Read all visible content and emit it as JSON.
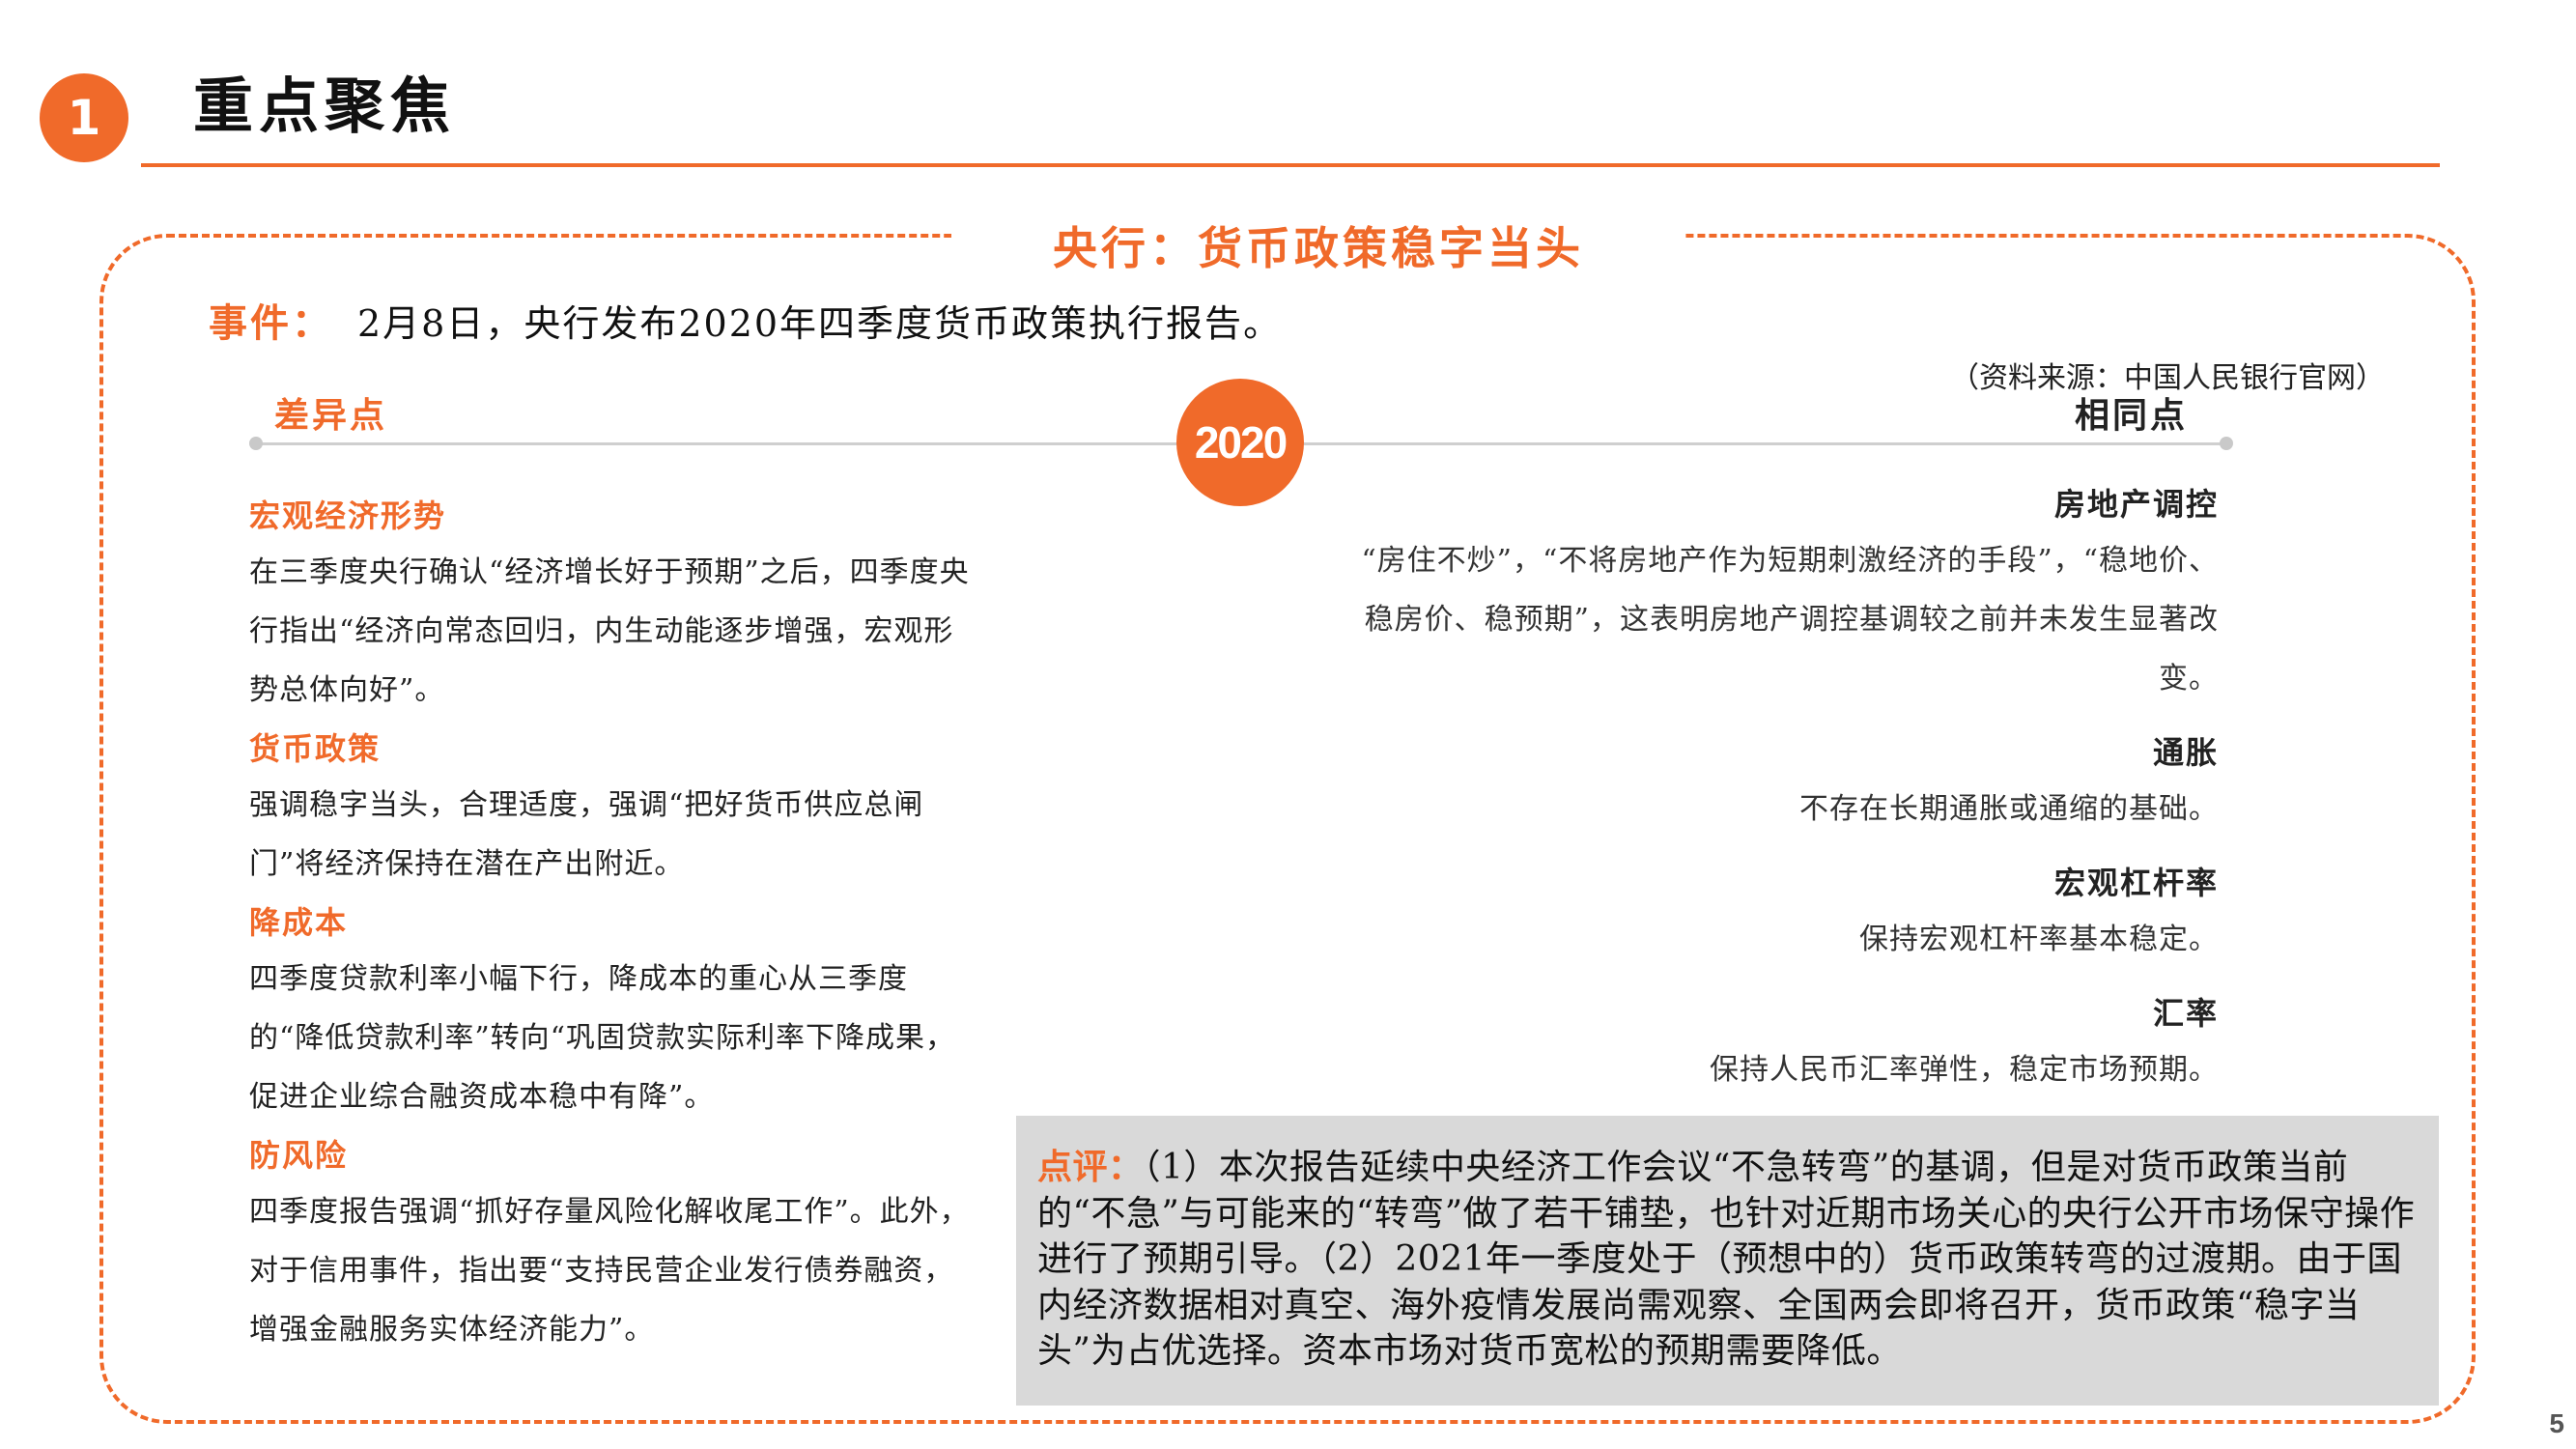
{
  "header": {
    "section_number": "1",
    "section_title": "重点聚焦"
  },
  "main_title": "央行：货币政策稳字当头",
  "event": {
    "label": "事件：",
    "text": "2月8日，央行发布2020年四季度货币政策执行报告。"
  },
  "source": "（资料来源：中国人民银行官网）",
  "timeline": {
    "year": "2020",
    "diff_label": "差异点",
    "same_label": "相同点"
  },
  "differences": [
    {
      "heading": "宏观经济形势",
      "text": "在三季度央行确认“经济增长好于预期”之后，四季度央行指出“经济向常态回归，内生动能逐步增强，宏观形势总体向好”。"
    },
    {
      "heading": "货币政策",
      "text": "强调稳字当头，合理适度，强调“把好货币供应总闸门”将经济保持在潜在产出附近。"
    },
    {
      "heading": "降成本",
      "text": "四季度贷款利率小幅下行，降成本的重心从三季度的“降低贷款利率”转向“巩固贷款实际利率下降成果，促进企业综合融资成本稳中有降”。"
    },
    {
      "heading": "防风险",
      "text": "四季度报告强调“抓好存量风险化解收尾工作”。此外，对于信用事件，指出要“支持民营企业发行债券融资，增强金融服务实体经济能力”。"
    }
  ],
  "similarities": [
    {
      "heading": "房地产调控",
      "text": "“房住不炒”，“不将房地产作为短期刺激经济的手段”，“稳地价、稳房价、稳预期”，这表明房地产调控基调较之前并未发生显著改变。"
    },
    {
      "heading": "通胀",
      "text": "不存在长期通胀或通缩的基础。"
    },
    {
      "heading": "宏观杠杆率",
      "text": "保持宏观杠杆率基本稳定。"
    },
    {
      "heading": "汇率",
      "text": "保持人民币汇率弹性，稳定市场预期。"
    }
  ],
  "comment": {
    "label": "点评：",
    "text": "（1）本次报告延续中央经济工作会议“不急转弯”的基调，但是对货币政策当前的“不急”与可能来的“转弯”做了若干铺垫，也针对近期市场关心的央行公开市场保守操作进行了预期引导。（2）2021年一季度处于（预想中的）货币政策转弯的过渡期。由于国内经济数据相对真空、海外疫情发展尚需观察、全国两会即将召开，货币政策“稳字当头”为占优选择。资本市场对货币宽松的预期需要降低。"
  },
  "page_number": "5",
  "colors": {
    "accent": "#f06a2a",
    "comment_bg": "#d9d9d9",
    "timeline": "#cfcfcf"
  }
}
